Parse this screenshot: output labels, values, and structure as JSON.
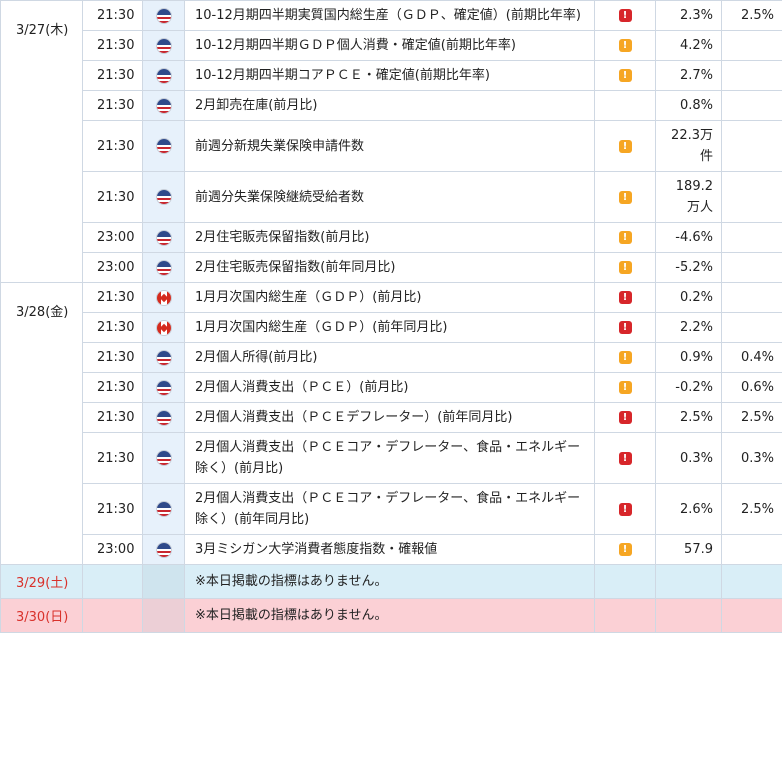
{
  "colors": {
    "high": "#d7262a",
    "mid": "#f6a623",
    "flag_col": "#e7f1fb",
    "sat_bg": "#d9eef7",
    "sun_bg": "#fbd0d5",
    "weekend_date": "#d9312b"
  },
  "days": [
    {
      "date": "3/27(木)",
      "rows": [
        {
          "time": "21:30",
          "country": "US",
          "flag_icon": "us-flag-icon",
          "indicator": "10-12月期四半期実質国内総生産（ＧＤＰ、確定値）(前期比年率)",
          "importance": "high",
          "previous": "2.3%",
          "forecast": "2.5%"
        },
        {
          "time": "21:30",
          "country": "US",
          "flag_icon": "us-flag-icon",
          "indicator": "10-12月期四半期ＧＤＰ個人消費・確定値(前期比年率)",
          "importance": "mid",
          "previous": "4.2%",
          "forecast": ""
        },
        {
          "time": "21:30",
          "country": "US",
          "flag_icon": "us-flag-icon",
          "indicator": "10-12月期四半期コアＰＣＥ・確定値(前期比年率)",
          "importance": "mid",
          "previous": "2.7%",
          "forecast": ""
        },
        {
          "time": "21:30",
          "country": "US",
          "flag_icon": "us-flag-icon",
          "indicator": "2月卸売在庫(前月比)",
          "importance": "",
          "previous": "0.8%",
          "forecast": ""
        },
        {
          "time": "21:30",
          "country": "US",
          "flag_icon": "us-flag-icon",
          "indicator": "前週分新規失業保険申請件数",
          "importance": "mid",
          "previous": "22.3万件",
          "forecast": ""
        },
        {
          "time": "21:30",
          "country": "US",
          "flag_icon": "us-flag-icon",
          "indicator": "前週分失業保険継続受給者数",
          "importance": "mid",
          "previous": "189.2万人",
          "forecast": ""
        },
        {
          "time": "23:00",
          "country": "US",
          "flag_icon": "us-flag-icon",
          "indicator": "2月住宅販売保留指数(前月比)",
          "importance": "mid",
          "previous": "-4.6%",
          "forecast": ""
        },
        {
          "time": "23:00",
          "country": "US",
          "flag_icon": "us-flag-icon",
          "indicator": "2月住宅販売保留指数(前年同月比)",
          "importance": "mid",
          "previous": "-5.2%",
          "forecast": ""
        }
      ]
    },
    {
      "date": "3/28(金)",
      "rows": [
        {
          "time": "21:30",
          "country": "CA",
          "flag_icon": "ca-flag-icon",
          "indicator": "1月月次国内総生産（ＧＤＰ）(前月比)",
          "importance": "high",
          "previous": "0.2%",
          "forecast": ""
        },
        {
          "time": "21:30",
          "country": "CA",
          "flag_icon": "ca-flag-icon",
          "indicator": "1月月次国内総生産（ＧＤＰ）(前年同月比)",
          "importance": "high",
          "previous": "2.2%",
          "forecast": ""
        },
        {
          "time": "21:30",
          "country": "US",
          "flag_icon": "us-flag-icon",
          "indicator": "2月個人所得(前月比)",
          "importance": "mid",
          "previous": "0.9%",
          "forecast": "0.4%"
        },
        {
          "time": "21:30",
          "country": "US",
          "flag_icon": "us-flag-icon",
          "indicator": "2月個人消費支出（ＰＣＥ）(前月比)",
          "importance": "mid",
          "previous": "-0.2%",
          "forecast": "0.6%"
        },
        {
          "time": "21:30",
          "country": "US",
          "flag_icon": "us-flag-icon",
          "indicator": "2月個人消費支出（ＰＣＥデフレーター）(前年同月比)",
          "importance": "high",
          "previous": "2.5%",
          "forecast": "2.5%"
        },
        {
          "time": "21:30",
          "country": "US",
          "flag_icon": "us-flag-icon",
          "indicator": "2月個人消費支出（ＰＣＥコア・デフレーター、食品・エネルギー除く）(前月比)",
          "importance": "high",
          "previous": "0.3%",
          "forecast": "0.3%"
        },
        {
          "time": "21:30",
          "country": "US",
          "flag_icon": "us-flag-icon",
          "indicator": "2月個人消費支出（ＰＣＥコア・デフレーター、食品・エネルギー除く）(前年同月比)",
          "importance": "high",
          "previous": "2.6%",
          "forecast": "2.5%"
        },
        {
          "time": "23:00",
          "country": "US",
          "flag_icon": "us-flag-icon",
          "indicator": "3月ミシガン大学消費者態度指数・確報値",
          "importance": "mid",
          "previous": "57.9",
          "forecast": ""
        }
      ]
    }
  ],
  "weekend": [
    {
      "date": "3/29(土)",
      "kind": "sat",
      "message": "※本日掲載の指標はありません。"
    },
    {
      "date": "3/30(日)",
      "kind": "sun",
      "message": "※本日掲載の指標はありません。"
    }
  ]
}
